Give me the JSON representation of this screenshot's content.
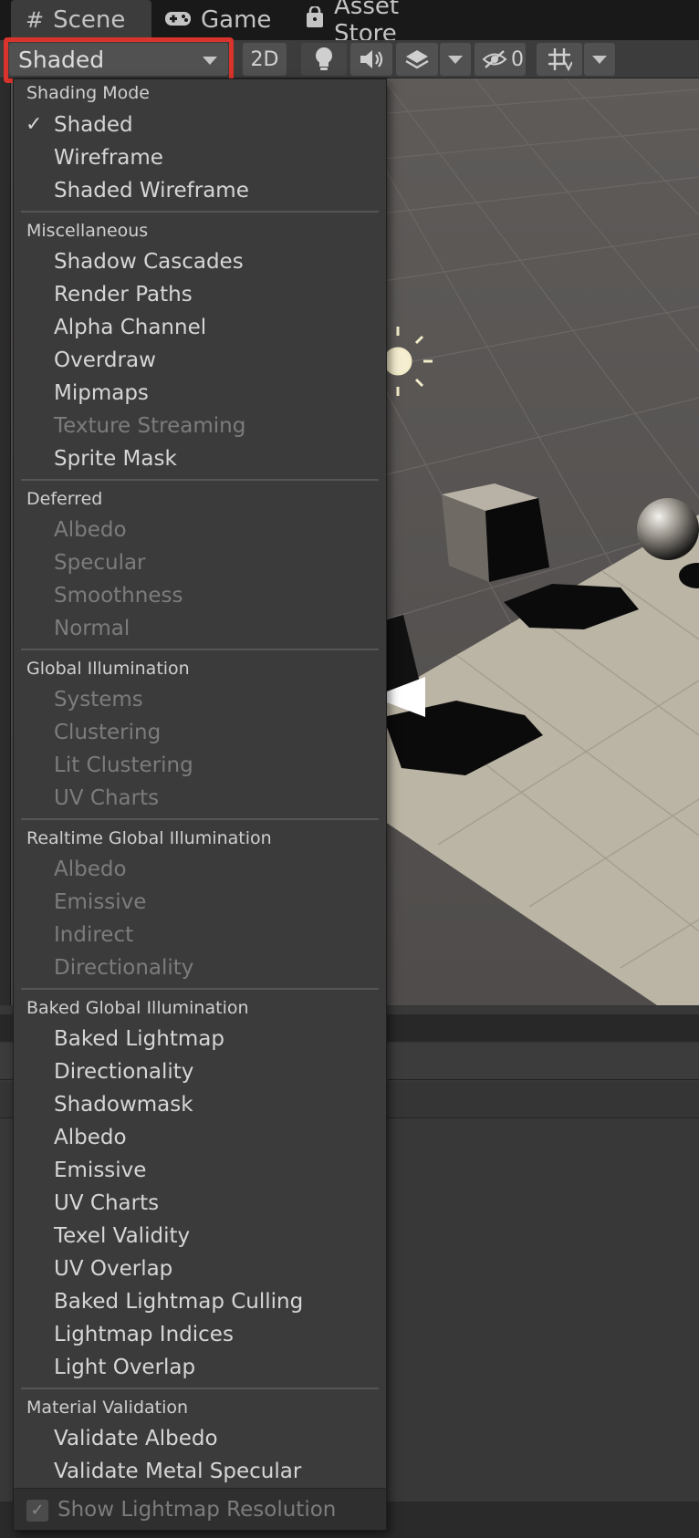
{
  "tabs": [
    {
      "label": "Scene",
      "icon": "hash-icon"
    },
    {
      "label": "Game",
      "icon": "gamepad-icon"
    },
    {
      "label": "Asset Store",
      "icon": "bag-icon"
    }
  ],
  "toolbar": {
    "draw_mode": "Shaded",
    "mode_2d": "2D",
    "hidden_count": "0"
  },
  "menu": {
    "shading_mode": {
      "header": "Shading Mode",
      "checked_mark": "✓",
      "items": [
        "Shaded",
        "Wireframe",
        "Shaded Wireframe"
      ]
    },
    "misc": {
      "header": "Miscellaneous",
      "items": [
        "Shadow Cascades",
        "Render Paths",
        "Alpha Channel",
        "Overdraw",
        "Mipmaps",
        "Texture Streaming",
        "Sprite Mask"
      ]
    },
    "deferred": {
      "header": "Deferred",
      "items": [
        "Albedo",
        "Specular",
        "Smoothness",
        "Normal"
      ]
    },
    "gi": {
      "header": "Global Illumination",
      "items": [
        "Systems",
        "Clustering",
        "Lit Clustering",
        "UV Charts"
      ]
    },
    "rtgi": {
      "header": "Realtime Global Illumination",
      "items": [
        "Albedo",
        "Emissive",
        "Indirect",
        "Directionality"
      ]
    },
    "baked": {
      "header": "Baked Global Illumination",
      "items": [
        "Baked Lightmap",
        "Directionality",
        "Shadowmask",
        "Albedo",
        "Emissive",
        "UV Charts",
        "Texel Validity",
        "UV Overlap",
        "Baked Lightmap Culling",
        "Lightmap Indices",
        "Light Overlap"
      ]
    },
    "material": {
      "header": "Material Validation",
      "items": [
        "Validate Albedo",
        "Validate Metal Specular"
      ]
    },
    "footer": {
      "checkbox_mark": "✓",
      "label": "Show Lightmap Resolution"
    }
  },
  "colors": {
    "highlight": "#d9342b",
    "disabled_text": "#7c7c7c",
    "enabled_text": "#d6d6d6"
  }
}
